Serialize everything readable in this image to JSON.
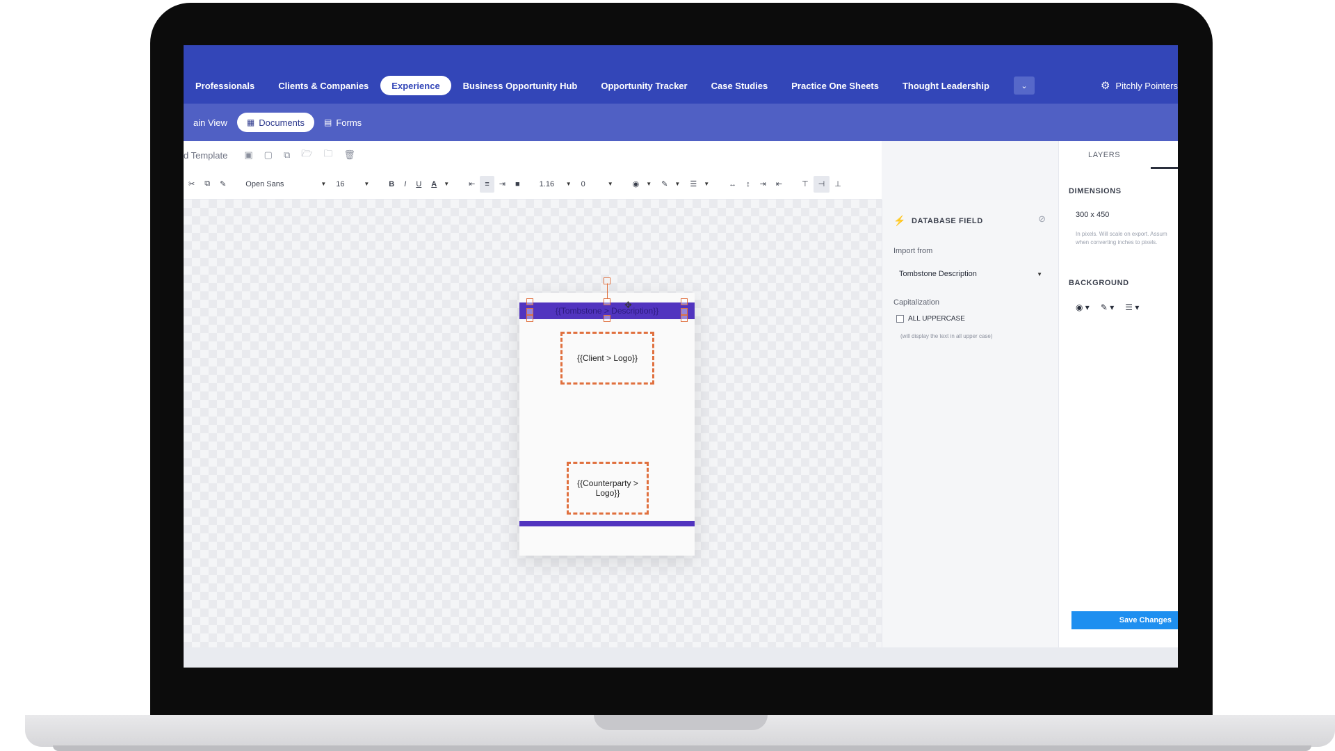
{
  "nav": {
    "items": [
      "Professionals",
      "Clients & Companies",
      "Experience",
      "Business Opportunity Hub",
      "Opportunity Tracker",
      "Case Studies",
      "Practice One Sheets",
      "Thought Leadership"
    ],
    "active": "Experience",
    "more_icon": "chevron-down-icon"
  },
  "account": {
    "name": "Pitchly Pointers",
    "icon": "gear-icon"
  },
  "subnav": {
    "items": [
      "ain View",
      "Documents",
      "Forms"
    ],
    "active": "Documents"
  },
  "template_bar": {
    "title": "d Template"
  },
  "toolbar": {
    "font_family": "Open Sans",
    "font_size": "16",
    "bold": "B",
    "italic": "I",
    "underline": "U",
    "font_color": "A",
    "line_height": "1.16",
    "letter_spacing": "0"
  },
  "document": {
    "header_text": "{{Tombstone > Description}}",
    "client_logo": "{{Client > Logo}}",
    "counterparty_logo": "{{Counterparty > Logo}}",
    "band_color": "#5134bf",
    "placeholder_border_color": "#e0703e"
  },
  "inspector": {
    "title": "DATABASE FIELD",
    "import_label": "Import from",
    "import_value": "Tombstone Description",
    "cap_label": "Capitalization",
    "checkbox_label": "ALL UPPERCASE",
    "checkbox_hint": "(will display the text in all upper case)"
  },
  "right_panel": {
    "tab": "LAYERS",
    "dimensions_label": "DIMENSIONS",
    "dimensions_value": "300 x 450",
    "dimensions_hint": "In pixels. Will scale on export. Assum when converting inches to pixels.",
    "background_label": "BACKGROUND",
    "save_label": "Save Changes"
  },
  "colors": {
    "nav_bg": "#3346b8",
    "subnav_bg": "#5060c4",
    "accent": "#1e8ff0"
  }
}
